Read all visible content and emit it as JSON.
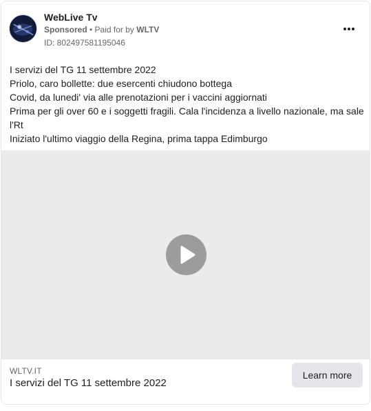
{
  "header": {
    "page_name": "WebLive Tv",
    "sponsored_label": "Sponsored",
    "paid_prefix": " • Paid for by ",
    "paid_by": "WLTV",
    "ad_id": "ID: 802497581195046",
    "avatar_icon": "weblive-tv-logo",
    "more_icon": "more-horizontal-icon"
  },
  "body": {
    "lines": [
      "I servizi del TG 11 settembre 2022",
      "Priolo, caro bollette: due esercenti chiudono bottega",
      "Covid, da lunedi' via alle prenotazioni per i vaccini aggiornati",
      "Prima per gli over 60 e i soggetti fragili. Cala l'incidenza a livello nazionale, ma sale l'Rt",
      "Iniziato l'ultimo viaggio della Regina, prima tappa Edimburgo"
    ]
  },
  "media": {
    "type": "video",
    "play_icon": "play-icon",
    "background_color": "#ebebeb"
  },
  "footer": {
    "domain": "WLTV.IT",
    "headline": "I servizi del TG 11 settembre 2022",
    "cta_label": "Learn more"
  }
}
